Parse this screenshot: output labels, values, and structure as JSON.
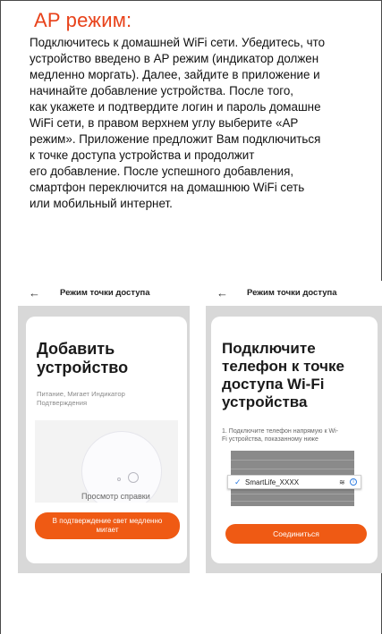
{
  "title": "AP режим:",
  "paragraph_lines": [
    "Подключитесь к домашней WiFi сети. Убедитесь, что",
    "устройство введено в AP режим (индикатор должен",
    "медленно моргать). Далее, зайдите в приложение и",
    "начинайте добавление устройства. После того,",
    "как укажете и подтвердите логин и пароль домашне",
    "WiFi сети, в правом верхнем углу выберите «AP",
    "режим». Приложение предложит Вам подключиться",
    "к точке доступа устройства и продолжит",
    "его добавление. После успешного добавления,",
    "смартфон переключится на домашнюю WiFi сеть",
    "или мобильный интернет."
  ],
  "screen1": {
    "back_icon": "←",
    "bar_title": "Режим точки доступа",
    "heading_line1": "Добавить",
    "heading_line2": "устройство",
    "hint_line1": "Питание, Мигает Индикатор",
    "hint_line2": "Подтверждения",
    "help_link": "Просмотр справки",
    "button_line1": "В подтверждение свет медленно",
    "button_line2": "мигает"
  },
  "screen2": {
    "back_icon": "←",
    "bar_title": "Режим точки доступа",
    "heading_line1": "Подключите",
    "heading_line2": "телефон к точке",
    "heading_line3": "доступа Wi-Fi",
    "heading_line4": "устройства",
    "step_line1": "1. Подключите телефон напрямую к Wi-",
    "step_line2": "Fi устройства, показанному ниже",
    "network_name": "SmartLife_XXXX",
    "connect_button": "Соединиться"
  },
  "colors": {
    "accent": "#ef5a14",
    "title": "#e8421a",
    "link_blue": "#2f7de1"
  },
  "icons": {
    "back": "back-arrow-icon",
    "check": "checkmark-icon",
    "wifi": "wifi-icon",
    "info": "info-icon"
  }
}
